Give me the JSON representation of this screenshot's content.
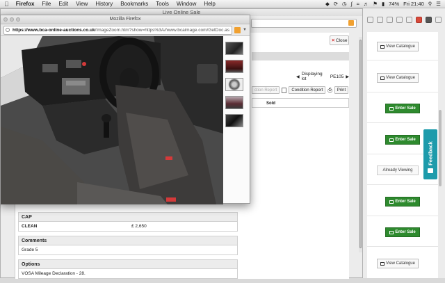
{
  "menubar": {
    "app_name": "Firefox",
    "menus": [
      "File",
      "Edit",
      "View",
      "History",
      "Bookmarks",
      "Tools",
      "Window",
      "Help"
    ],
    "battery": "74%",
    "clock": "Fri 21:40"
  },
  "main_window": {
    "title": "Live Online Sale",
    "close_label": "Close",
    "lot_label": "Displaying lot",
    "lot_number": "PE105",
    "buttons": {
      "inspection_report": "ction Report",
      "condition_report": "Condition Report",
      "print": "Print"
    },
    "status": "Sold",
    "sections": [
      {
        "heading": "CAP",
        "row_label": "CLEAN",
        "row_value": "£ 2,650"
      },
      {
        "heading": "Comments",
        "row_label": "Grade 5"
      },
      {
        "heading": "Options",
        "row_label": "VOSA Mileage Declaration - 28."
      }
    ]
  },
  "right_list": {
    "view_catalogue": "View Catalogue",
    "enter_sale": "Enter Sale",
    "already_viewing": "Already Viewing",
    "feedback": "Feedback"
  },
  "popup": {
    "title": "Mozilla Firefox",
    "url_host": "https://www.bca-online-auctions.co.uk",
    "url_rest": "/ImageZoom.htm?show=https%3A//www.bcaimage.com/GetDoc.as",
    "main_image": "car-interior-photo",
    "thumbnails": [
      "interior-thumb",
      "dashboard-thumb",
      "wheel-thumb",
      "rear-thumb",
      "seats-thumb"
    ]
  },
  "colors": {
    "enter_sale_green": "#2e8a2e",
    "feedback_teal": "#1d9bab",
    "rss_orange": "#f0a030"
  }
}
